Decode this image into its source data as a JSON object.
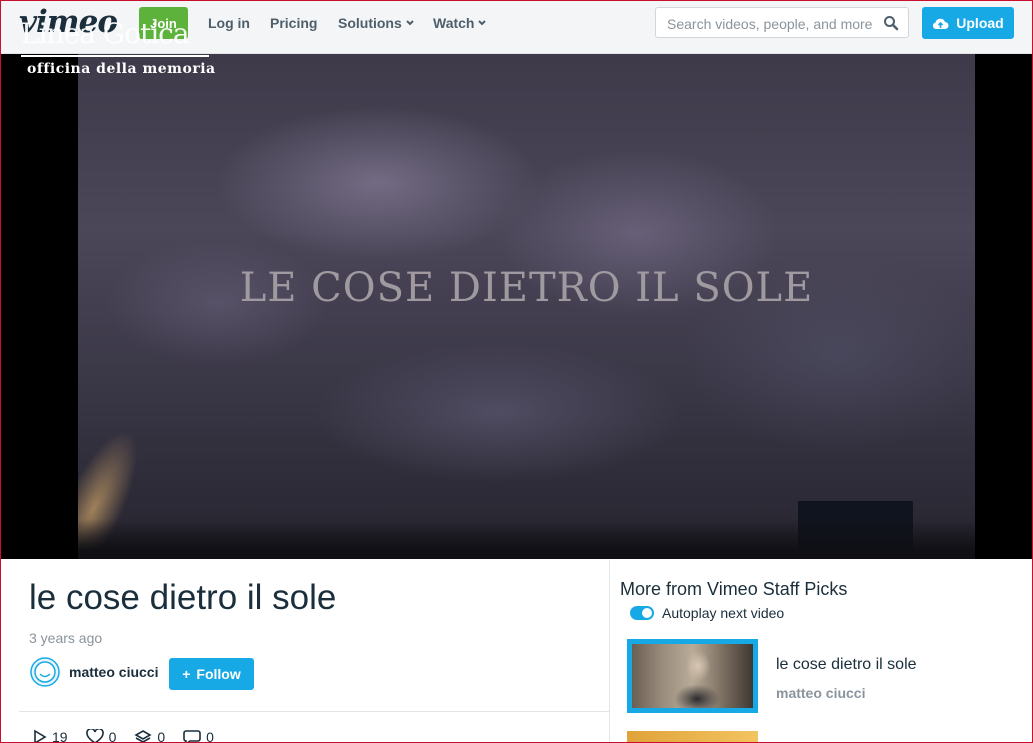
{
  "nav": {
    "logo": "vimeo",
    "join": "Join",
    "login": "Log in",
    "pricing": "Pricing",
    "solutions": "Solutions",
    "watch": "Watch",
    "search_placeholder": "Search videos, people, and more",
    "upload": "Upload"
  },
  "video": {
    "overlay_title": "LE COSE DIETRO IL SOLE",
    "watermark_main": "Linea Gotica",
    "watermark_sub": "officina della memoria"
  },
  "info": {
    "title": "le cose dietro il sole",
    "time": "3 years ago",
    "owner": "matteo ciucci",
    "follow": "Follow",
    "stats": {
      "plays": "19",
      "likes": "0",
      "collections": "0",
      "comments": "0"
    }
  },
  "sidebar": {
    "title": "More from Vimeo Staff Picks",
    "autoplay": "Autoplay next video",
    "items": [
      {
        "title": "le cose dietro il sole",
        "owner": "matteo ciucci"
      }
    ]
  },
  "colors": {
    "accent": "#17a9e6",
    "join": "#5cb23a",
    "text": "#1a2e3b",
    "muted": "#8a949c"
  }
}
